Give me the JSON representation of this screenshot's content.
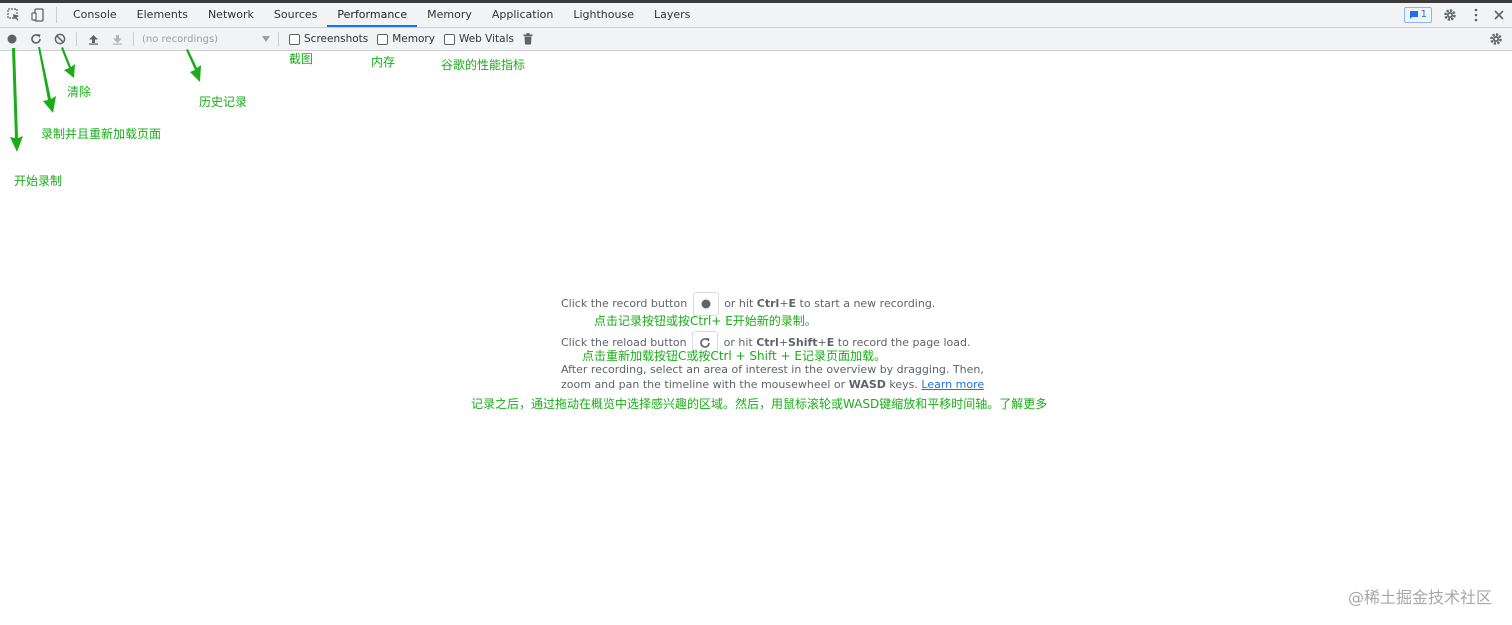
{
  "tabs": [
    {
      "label": "Console"
    },
    {
      "label": "Elements"
    },
    {
      "label": "Network"
    },
    {
      "label": "Sources"
    },
    {
      "label": "Performance",
      "active": true
    },
    {
      "label": "Memory"
    },
    {
      "label": "Application"
    },
    {
      "label": "Lighthouse"
    },
    {
      "label": "Layers"
    }
  ],
  "issues_badge": "1",
  "toolbar": {
    "recordings_placeholder": "(no recordings)",
    "screenshots_label": "Screenshots",
    "memory_label": "Memory",
    "web_vitals_label": "Web Vitals"
  },
  "annotations": {
    "screenshots": "截图",
    "memory": "内存",
    "web_vitals": "谷歌的性能指标",
    "clear": "清除",
    "history": "历史记录",
    "reload_record": "录制并且重新加载页面",
    "start_record": "开始录制"
  },
  "landing": {
    "record_pre": "Click the record button",
    "record_mid": "or hit",
    "record_key1": "Ctrl",
    "record_plus": "+",
    "record_key2": "E",
    "record_post": "to start a new recording.",
    "reload_pre": "Click the reload button",
    "reload_mid": "or hit",
    "reload_key1": "Ctrl",
    "reload_key2": "Shift",
    "reload_key3": "E",
    "reload_post": "to record the page load.",
    "after1": "After recording, select an area of interest in the overview by dragging. Then,",
    "after2_pre": "zoom and pan the timeline with the mousewheel or",
    "after2_key": "WASD",
    "after2_post": "keys.",
    "learn_more": "Learn more",
    "cn_record": "点击记录按钮或按Ctrl+ E开始新的录制。",
    "cn_reload": "点击重新加载按钮C或按Ctrl + Shift + E记录页面加载。",
    "cn_after": "记录之后，通过拖动在概览中选择感兴趣的区域。然后，用鼠标滚轮或WASD键缩放和平移时间轴。了解更多"
  },
  "watermark": "@稀土掘金技术社区",
  "colors": {
    "annotation": "#1aad19",
    "active_tab": "#1a73e8"
  }
}
